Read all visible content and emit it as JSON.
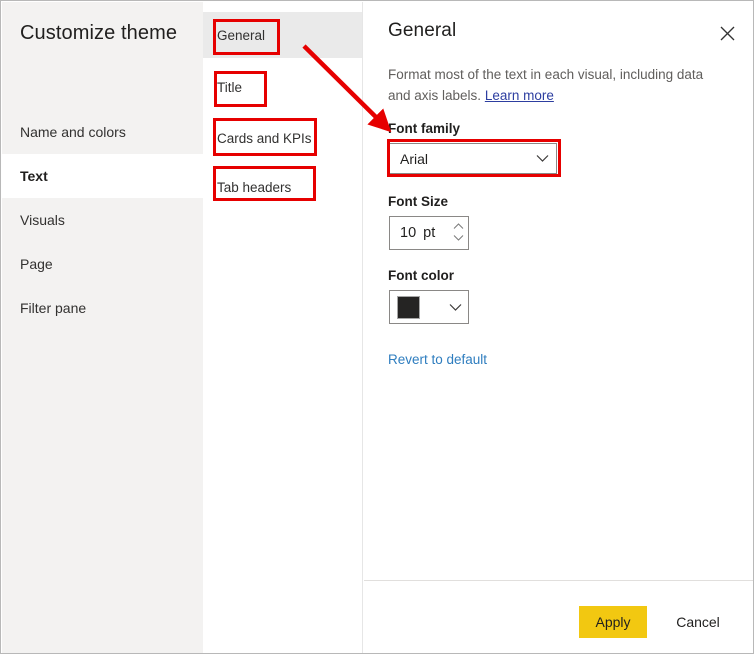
{
  "window": {
    "accent_color": "#f2c811",
    "annotation_color": "#e60000"
  },
  "sidebar": {
    "title": "Customize theme",
    "items": [
      {
        "label": "Name and colors",
        "selected": false
      },
      {
        "label": "Text",
        "selected": true
      },
      {
        "label": "Visuals",
        "selected": false
      },
      {
        "label": "Page",
        "selected": false
      },
      {
        "label": "Filter pane",
        "selected": false
      }
    ]
  },
  "middle_column": {
    "items": [
      {
        "label": "General",
        "selected": true
      },
      {
        "label": "Title",
        "selected": false
      },
      {
        "label": "Cards and KPIs",
        "selected": false
      },
      {
        "label": "Tab headers",
        "selected": false
      }
    ]
  },
  "panel": {
    "title": "General",
    "close_icon": "close-icon",
    "description": "Format most of the text in each visual, including data and axis labels.",
    "learn_more_label": "Learn more",
    "font_family": {
      "label": "Font family",
      "value": "Arial",
      "chevron_icon": "chevron-down-icon"
    },
    "font_size": {
      "label": "Font Size",
      "value": "10",
      "unit": "pt",
      "increment_icon": "chevron-up-icon",
      "decrement_icon": "chevron-down-icon"
    },
    "font_color": {
      "label": "Font color",
      "swatch_color": "#252423",
      "chevron_icon": "chevron-down-icon"
    },
    "revert_label": "Revert to default"
  },
  "footer": {
    "apply_label": "Apply",
    "cancel_label": "Cancel"
  }
}
